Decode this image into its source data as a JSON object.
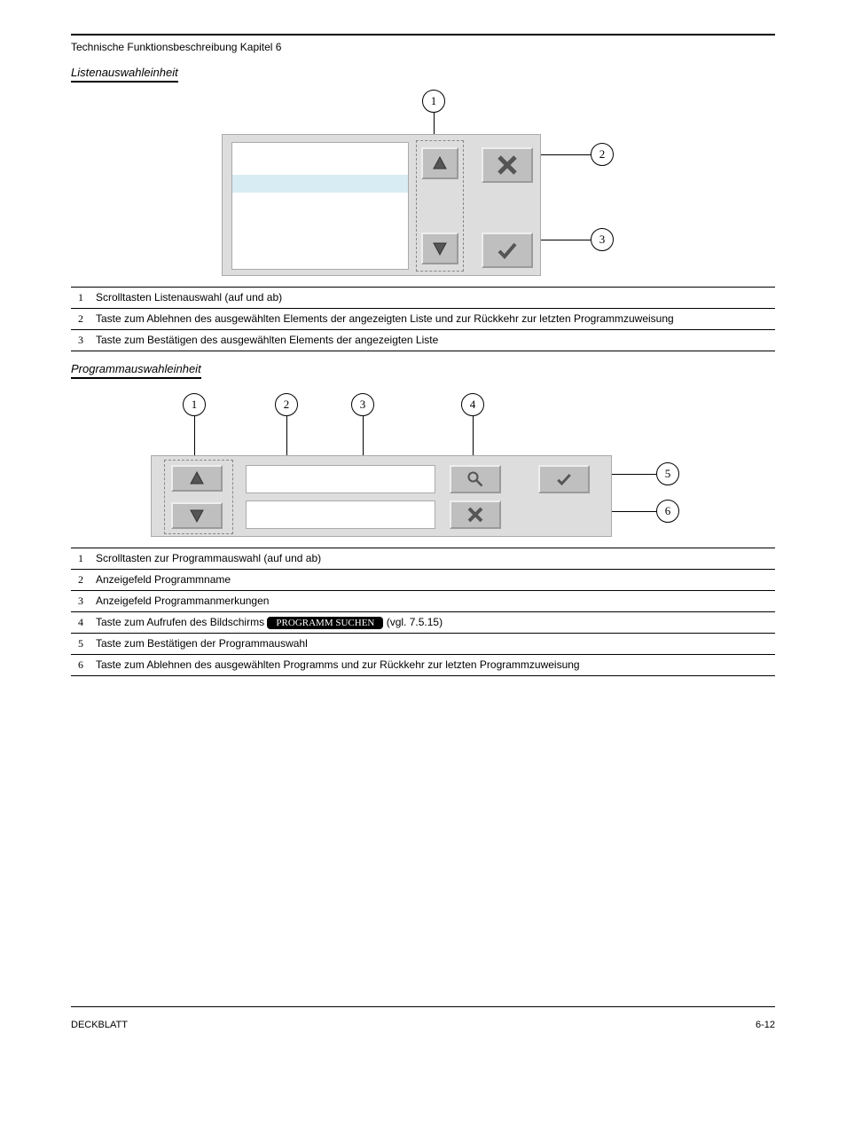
{
  "chapter_line": "Technische Funktionsbeschreibung Kapitel 6",
  "section1_title": "Listenauswahleinheit",
  "fig1": {
    "labels": {
      "l1": "1",
      "l2": "2",
      "l3": "3"
    },
    "rows": [
      {
        "n": "1",
        "txt": "Scrolltasten Listenauswahl (auf und ab)"
      },
      {
        "n": "2",
        "txt": "Taste zum Ablehnen des ausgewählten Elements der angezeigten Liste und zur Rückkehr zur letzten Programmzuweisung"
      },
      {
        "n": "3",
        "txt": "Taste zum Bestätigen des ausgewählten Elements der angezeigten Liste"
      }
    ]
  },
  "section2_title": "Programmauswahleinheit",
  "fig2": {
    "labels": {
      "l1": "1",
      "l2": "2",
      "l3": "3",
      "l4": "4",
      "l5": "5",
      "l6": "6"
    },
    "rows": [
      {
        "n": "1",
        "txt": "Scrolltasten zur Programmauswahl (auf und ab)"
      },
      {
        "n": "2",
        "txt": "Anzeigefeld Programmname"
      },
      {
        "n": "3",
        "txt": "Anzeigefeld Programmanmerkungen"
      },
      {
        "n": "4",
        "txt_pre": "Taste zum Aufrufen des Bildschirms ",
        "badge": "PROGRAMM SUCHEN",
        "txt_post": " (vgl. 7.5.15)"
      },
      {
        "n": "5",
        "txt": "Taste zum Bestätigen der Programmauswahl"
      },
      {
        "n": "6",
        "txt": "Taste zum Ablehnen des ausgewählten Programms und zur Rückkehr zur letzten Programmzuweisung"
      }
    ]
  },
  "footer": {
    "left": "DECKBLATT",
    "right": "6-12"
  }
}
